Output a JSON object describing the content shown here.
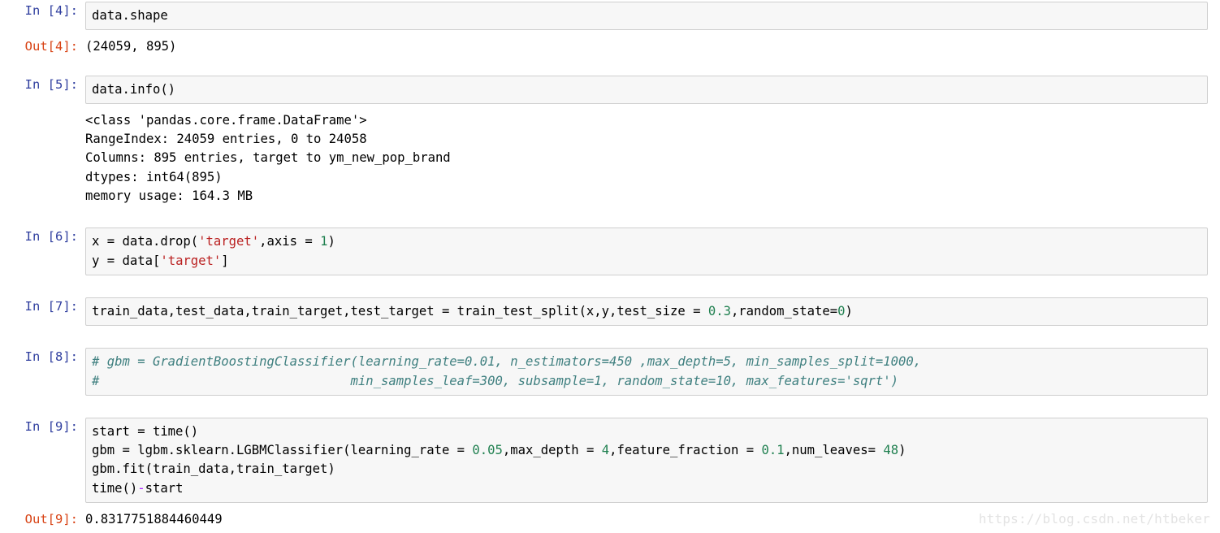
{
  "notebook": {
    "kernel_language": "python",
    "cells": [
      {
        "type": "code",
        "prompt": "In [4]:",
        "source": "data.shape"
      },
      {
        "type": "output",
        "prompt": "Out[4]:",
        "text": "(24059, 895)"
      },
      {
        "type": "code",
        "prompt": "In [5]:",
        "source": "data.info()"
      },
      {
        "type": "output",
        "prompt": "",
        "text": "<class 'pandas.core.frame.DataFrame'>\nRangeIndex: 24059 entries, 0 to 24058\nColumns: 895 entries, target to ym_new_pop_brand\ndtypes: int64(895)\nmemory usage: 164.3 MB"
      },
      {
        "type": "code",
        "prompt": "In [6]:",
        "source": "x = data.drop('target',axis = 1)\ny = data['target']"
      },
      {
        "type": "code",
        "prompt": "In [7]:",
        "source": "train_data,test_data,train_target,test_target = train_test_split(x,y,test_size = 0.3,random_state=0)"
      },
      {
        "type": "code",
        "prompt": "In [8]:",
        "source": "# gbm = GradientBoostingClassifier(learning_rate=0.01, n_estimators=450 ,max_depth=5, min_samples_split=1000,\n#                                 min_samples_leaf=300, subsample=1, random_state=10, max_features='sqrt')"
      },
      {
        "type": "code",
        "prompt": "In [9]:",
        "source": "start = time()\ngbm = lgbm.sklearn.LGBMClassifier(learning_rate = 0.05,max_depth = 4,feature_fraction = 0.1,num_leaves= 48)\ngbm.fit(train_data,train_target)\ntime()-start"
      },
      {
        "type": "output",
        "prompt": "Out[9]:",
        "text": "0.8317751884460449"
      }
    ]
  },
  "watermark": {
    "text": "https://blog.csdn.net/htbeker"
  },
  "colors": {
    "in_prompt": "#303F9F",
    "out_prompt": "#D84315",
    "cell_background": "#f7f7f7",
    "cell_border": "#cfcfcf",
    "string_token": "#BA2121",
    "number_token": "#208050",
    "comment_token": "#408080",
    "operator_token": "#AA22FF",
    "watermark_text": "#e3e3e3"
  }
}
